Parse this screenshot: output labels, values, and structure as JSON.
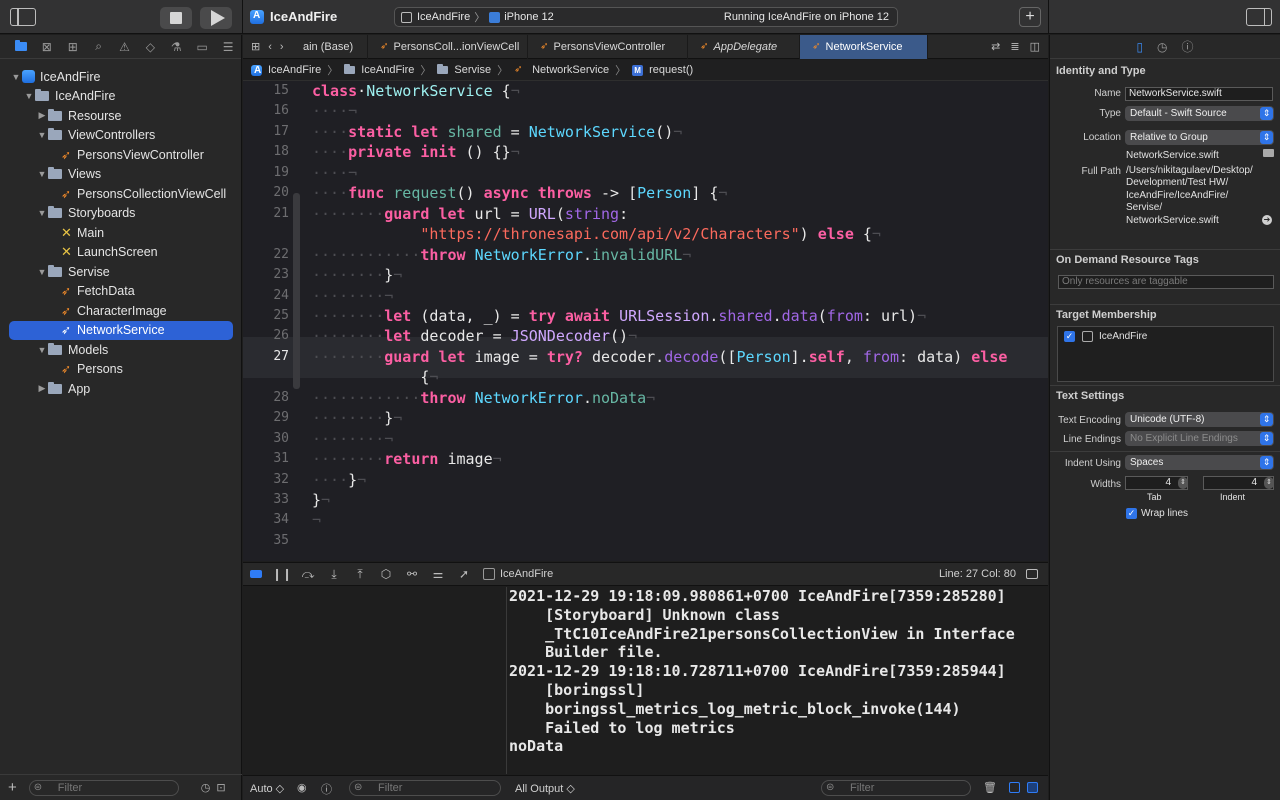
{
  "window": {
    "project_title": "IceAndFire",
    "scheme": "IceAndFire",
    "destination": "iPhone 12",
    "status": "Running IceAndFire on iPhone 12"
  },
  "navigator": {
    "tree": [
      {
        "label": "IceAndFire",
        "kind": "project",
        "indent": 0,
        "disclosure": "open"
      },
      {
        "label": "IceAndFire",
        "kind": "folder",
        "indent": 1,
        "disclosure": "open"
      },
      {
        "label": "Resourse",
        "kind": "folder",
        "indent": 2,
        "disclosure": "closed"
      },
      {
        "label": "ViewControllers",
        "kind": "folder",
        "indent": 2,
        "disclosure": "open"
      },
      {
        "label": "PersonsViewController",
        "kind": "swift",
        "indent": 3,
        "disclosure": "none"
      },
      {
        "label": "Views",
        "kind": "folder",
        "indent": 2,
        "disclosure": "open"
      },
      {
        "label": "PersonsCollectionViewCell",
        "kind": "swift",
        "indent": 3,
        "disclosure": "none"
      },
      {
        "label": "Storyboards",
        "kind": "folder",
        "indent": 2,
        "disclosure": "open"
      },
      {
        "label": "Main",
        "kind": "storyboard",
        "indent": 3,
        "disclosure": "none"
      },
      {
        "label": "LaunchScreen",
        "kind": "storyboard",
        "indent": 3,
        "disclosure": "none"
      },
      {
        "label": "Servise",
        "kind": "folder",
        "indent": 2,
        "disclosure": "open"
      },
      {
        "label": "FetchData",
        "kind": "swift",
        "indent": 3,
        "disclosure": "none"
      },
      {
        "label": "CharacterImage",
        "kind": "swift",
        "indent": 3,
        "disclosure": "none"
      },
      {
        "label": "NetworkService",
        "kind": "swift",
        "indent": 3,
        "disclosure": "none",
        "selected": true
      },
      {
        "label": "Models",
        "kind": "folder",
        "indent": 2,
        "disclosure": "open"
      },
      {
        "label": "Persons",
        "kind": "swift",
        "indent": 3,
        "disclosure": "none"
      },
      {
        "label": "App",
        "kind": "folder",
        "indent": 2,
        "disclosure": "closed"
      }
    ],
    "filter_placeholder": "Filter"
  },
  "tabs": [
    {
      "label": "ain (Base)",
      "active": false,
      "icon": "none"
    },
    {
      "label": "PersonsColl...ionViewCell",
      "active": false,
      "icon": "swift"
    },
    {
      "label": "PersonsViewController",
      "active": false,
      "icon": "swift"
    },
    {
      "label": "AppDelegate",
      "active": false,
      "icon": "swift",
      "italic": true
    },
    {
      "label": "NetworkService",
      "active": true,
      "icon": "swift"
    }
  ],
  "breadcrumb": [
    "IceAndFire",
    "IceAndFire",
    "Servise",
    "NetworkService",
    "request()"
  ],
  "code": {
    "current_line": 27,
    "lines": [
      {
        "n": "15",
        "tokens": [
          [
            "kw",
            "class"
          ],
          [
            "",
            "·"
          ],
          [
            "cls",
            "NetworkService"
          ],
          [
            "",
            " {"
          ],
          [
            "ws",
            "¬"
          ]
        ]
      },
      {
        "n": "16",
        "tokens": [
          [
            "ws",
            "····¬"
          ]
        ]
      },
      {
        "n": "17",
        "tokens": [
          [
            "ws",
            "····"
          ],
          [
            "kw",
            "static"
          ],
          [
            "",
            " "
          ],
          [
            "kw",
            "let"
          ],
          [
            "",
            " "
          ],
          [
            "fn",
            "shared"
          ],
          [
            "",
            " = "
          ],
          [
            "ty",
            "NetworkService"
          ],
          [
            "",
            "()"
          ],
          [
            "ws",
            "¬"
          ]
        ]
      },
      {
        "n": "18",
        "tokens": [
          [
            "ws",
            "····"
          ],
          [
            "kw",
            "private"
          ],
          [
            "",
            " "
          ],
          [
            "kw",
            "init"
          ],
          [
            "",
            " () {}"
          ],
          [
            "ws",
            "¬"
          ]
        ]
      },
      {
        "n": "19",
        "tokens": [
          [
            "ws",
            "····¬"
          ]
        ]
      },
      {
        "n": "20",
        "tokens": [
          [
            "ws",
            "····"
          ],
          [
            "kw",
            "func"
          ],
          [
            "",
            " "
          ],
          [
            "fn",
            "request"
          ],
          [
            "",
            "() "
          ],
          [
            "kw",
            "async"
          ],
          [
            "",
            " "
          ],
          [
            "kw",
            "throws"
          ],
          [
            "",
            " -> ["
          ],
          [
            "ty",
            "Person"
          ],
          [
            "",
            "] {"
          ],
          [
            "ws",
            "¬"
          ]
        ]
      },
      {
        "n": "21",
        "tokens": [
          [
            "ws",
            "········"
          ],
          [
            "kw",
            "guard"
          ],
          [
            "",
            " "
          ],
          [
            "kw",
            "let"
          ],
          [
            "",
            " url = "
          ],
          [
            "ty2",
            "URL"
          ],
          [
            "",
            "("
          ],
          [
            "ps",
            "string"
          ],
          [
            "",
            ":"
          ]
        ]
      },
      {
        "n": "",
        "tokens": [
          [
            "",
            "            "
          ],
          [
            "str",
            "\"https://thronesapi.com/api/v2/Characters\""
          ],
          [
            "",
            ") "
          ],
          [
            "kw",
            "else"
          ],
          [
            "",
            " {"
          ],
          [
            "ws",
            "¬"
          ]
        ]
      },
      {
        "n": "22",
        "tokens": [
          [
            "ws",
            "············"
          ],
          [
            "kw",
            "throw"
          ],
          [
            "",
            " "
          ],
          [
            "ty",
            "NetworkError"
          ],
          [
            "",
            "."
          ],
          [
            "fn",
            "invalidURL"
          ],
          [
            "ws",
            "¬"
          ]
        ]
      },
      {
        "n": "23",
        "tokens": [
          [
            "ws",
            "········"
          ],
          [
            "",
            "}"
          ],
          [
            "ws",
            "¬"
          ]
        ]
      },
      {
        "n": "24",
        "tokens": [
          [
            "ws",
            "········¬"
          ]
        ]
      },
      {
        "n": "25",
        "tokens": [
          [
            "ws",
            "········"
          ],
          [
            "kw",
            "let"
          ],
          [
            "",
            " (data, _) = "
          ],
          [
            "kw",
            "try"
          ],
          [
            "",
            " "
          ],
          [
            "kw",
            "await"
          ],
          [
            "",
            " "
          ],
          [
            "ty2",
            "URLSession"
          ],
          [
            "",
            "."
          ],
          [
            "ps",
            "shared"
          ],
          [
            "",
            "."
          ],
          [
            "ps",
            "data"
          ],
          [
            "",
            "("
          ],
          [
            "ps",
            "from"
          ],
          [
            "",
            ": url)"
          ],
          [
            "ws",
            "¬"
          ]
        ]
      },
      {
        "n": "26",
        "tokens": [
          [
            "ws",
            "········"
          ],
          [
            "kw",
            "let"
          ],
          [
            "",
            " decoder = "
          ],
          [
            "ty2",
            "JSONDecoder"
          ],
          [
            "",
            "()"
          ],
          [
            "ws",
            "¬"
          ]
        ]
      },
      {
        "n": "27",
        "tokens": [
          [
            "ws",
            "········"
          ],
          [
            "kw",
            "guard"
          ],
          [
            "",
            " "
          ],
          [
            "kw",
            "let"
          ],
          [
            "",
            " image = "
          ],
          [
            "kw",
            "try?"
          ],
          [
            "",
            " decoder."
          ],
          [
            "ps",
            "decode"
          ],
          [
            "",
            "(["
          ],
          [
            "ty",
            "Person"
          ],
          [
            "",
            "]."
          ],
          [
            "kw",
            "self"
          ],
          [
            "",
            ", "
          ],
          [
            "ps",
            "from"
          ],
          [
            "",
            ": data) "
          ],
          [
            "kw",
            "else"
          ]
        ]
      },
      {
        "n": "",
        "tokens": [
          [
            "",
            "            {"
          ],
          [
            "ws",
            "¬"
          ]
        ]
      },
      {
        "n": "28",
        "tokens": [
          [
            "ws",
            "············"
          ],
          [
            "kw",
            "throw"
          ],
          [
            "",
            " "
          ],
          [
            "ty",
            "NetworkError"
          ],
          [
            "",
            "."
          ],
          [
            "fn",
            "noData"
          ],
          [
            "ws",
            "¬"
          ]
        ]
      },
      {
        "n": "29",
        "tokens": [
          [
            "ws",
            "········"
          ],
          [
            "",
            "}"
          ],
          [
            "ws",
            "¬"
          ]
        ]
      },
      {
        "n": "30",
        "tokens": [
          [
            "ws",
            "········¬"
          ]
        ]
      },
      {
        "n": "31",
        "tokens": [
          [
            "ws",
            "········"
          ],
          [
            "kw",
            "return"
          ],
          [
            "",
            " image"
          ],
          [
            "ws",
            "¬"
          ]
        ]
      },
      {
        "n": "32",
        "tokens": [
          [
            "ws",
            "····"
          ],
          [
            "",
            "}"
          ],
          [
            "ws",
            "¬"
          ]
        ]
      },
      {
        "n": "33",
        "tokens": [
          [
            "",
            "}"
          ],
          [
            "ws",
            "¬"
          ]
        ]
      },
      {
        "n": "34",
        "tokens": [
          [
            "ws",
            "¬"
          ]
        ]
      },
      {
        "n": "35",
        "tokens": []
      }
    ]
  },
  "debug": {
    "process": "IceAndFire",
    "position": "Line: 27  Col: 80",
    "console_lines": [
      "2021-12-29 19:18:09.980861+0700 IceAndFire[7359:285280]",
      "    [Storyboard] Unknown class",
      "    _TtC10IceAndFire21personsCollectionView in Interface",
      "    Builder file.",
      "2021-12-29 19:18:10.728711+0700 IceAndFire[7359:285944]",
      "    [boringssl]",
      "    boringssl_metrics_log_metric_block_invoke(144)",
      "    Failed to log metrics",
      "noData"
    ],
    "auto_label": "Auto ◇",
    "filter_placeholder": "Filter",
    "output_label": "All Output ◇",
    "console_filter_placeholder": "Filter"
  },
  "inspector": {
    "identity_title": "Identity and Type",
    "name_label": "Name",
    "name_value": "NetworkService.swift",
    "type_label": "Type",
    "type_value": "Default - Swift Source",
    "location_label": "Location",
    "location_value": "Relative to Group",
    "location_file": "NetworkService.swift",
    "fullpath_label": "Full Path",
    "fullpath_lines": [
      "/Users/nikitagulaev/Desktop/",
      "Development/Test HW/",
      "IceAndFire/IceAndFire/",
      "Servise/",
      "NetworkService.swift"
    ],
    "odr_title": "On Demand Resource Tags",
    "odr_placeholder": "Only resources are taggable",
    "target_title": "Target Membership",
    "target_name": "IceAndFire",
    "text_title": "Text Settings",
    "encoding_label": "Text Encoding",
    "encoding_value": "Unicode (UTF-8)",
    "endings_label": "Line Endings",
    "endings_value": "No Explicit Line Endings",
    "indent_label": "Indent Using",
    "indent_value": "Spaces",
    "widths_label": "Widths",
    "tab_width": "4",
    "indent_width": "4",
    "tab_caption": "Tab",
    "indent_caption": "Indent",
    "wrap_label": "Wrap lines"
  }
}
